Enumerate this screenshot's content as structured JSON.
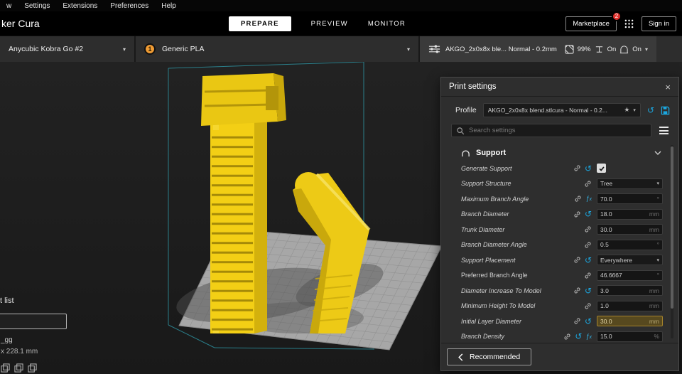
{
  "icons": {
    "caret": "▾",
    "reset": "↺",
    "star": "★",
    "close": "×"
  },
  "menu_bar": {
    "items": [
      "w",
      "Settings",
      "Extensions",
      "Preferences",
      "Help"
    ]
  },
  "title_bar": {
    "app_title": "ker Cura",
    "tabs": [
      {
        "label": "PREPARE"
      },
      {
        "label": "PREVIEW"
      },
      {
        "label": "MONITOR"
      }
    ],
    "marketplace_label": "Marketplace",
    "marketplace_badge": "2",
    "sign_in_label": "Sign in"
  },
  "config_bar": {
    "printer_name": "Anycubic Kobra Go #2",
    "extruder_number": "1",
    "material_name": "Generic PLA",
    "profile_summary": "AKGO_2x0x8x ble... Normal - 0.2mm",
    "infill_value": "99%",
    "support_state": "On",
    "adhesion_state": "On"
  },
  "viewport_overlay": {
    "object_list_label": "t list",
    "model_name": "_gg",
    "build_volume": "x 228.1 mm"
  },
  "panel": {
    "title": "Print settings",
    "profile_label": "Profile",
    "profile_value": "AKGO_2x0x8x blend.stlcura - Normal - 0.2...",
    "search_placeholder": "Search settings",
    "category": "Support",
    "recommended_label": "Recommended",
    "rows": [
      {
        "label": "Generate Support",
        "type": "checkbox",
        "checked": true
      },
      {
        "label": "Support Structure",
        "type": "dropdown",
        "value": "Tree"
      },
      {
        "label": "Maximum Branch Angle",
        "type": "input",
        "value": "70.0",
        "unit": "°"
      },
      {
        "label": "Branch Diameter",
        "type": "input",
        "value": "18.0",
        "unit": "mm"
      },
      {
        "label": "Trunk Diameter",
        "type": "input",
        "value": "30.0",
        "unit": "mm"
      },
      {
        "label": "Branch Diameter Angle",
        "type": "input",
        "value": "0.5",
        "unit": "°"
      },
      {
        "label": "Support Placement",
        "type": "dropdown",
        "value": "Everywhere"
      },
      {
        "label": "Preferred Branch Angle",
        "type": "input",
        "value": "46.6667",
        "unit": "°"
      },
      {
        "label": "Diameter Increase To Model",
        "type": "input",
        "value": "3.0",
        "unit": "mm"
      },
      {
        "label": "Minimum Height To Model",
        "type": "input",
        "value": "1.0",
        "unit": "mm"
      },
      {
        "label": "Initial Layer Diameter",
        "type": "input",
        "value": "30.0",
        "unit": "mm",
        "highlighted": true
      },
      {
        "label": "Branch Density",
        "type": "input",
        "value": "15.0",
        "unit": "%"
      }
    ]
  },
  "colors": {
    "accent_blue": "#1ba7e0",
    "model_yellow": "#f3cf15",
    "highlight_gold": "#a5832c",
    "badge_red": "#e0312d",
    "extruder_orange": "#ef9b34",
    "build_volume_teal": "#2f9fae"
  }
}
